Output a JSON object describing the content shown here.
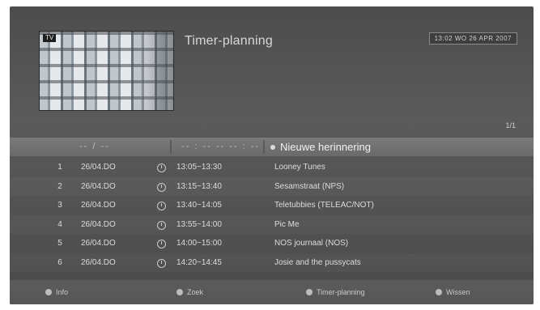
{
  "header": {
    "tv_tag": "TV",
    "title": "Timer-planning",
    "clock": "13:02 WO 26 APR 2007",
    "pager": "1/1"
  },
  "columns": {
    "date_placeholder": "-- / --",
    "time_placeholder": "-- : -- -- -- : --",
    "new_reminder": "Nieuwe herinnering"
  },
  "timers": [
    {
      "num": "1",
      "date": "26/04.DO",
      "time": "13:05~13:30",
      "program": "Looney Tunes"
    },
    {
      "num": "2",
      "date": "26/04.DO",
      "time": "13:15~13:40",
      "program": "Sesamstraat (NPS)"
    },
    {
      "num": "3",
      "date": "26/04.DO",
      "time": "13:40~14:05",
      "program": "Teletubbies (TELEAC/NOT)"
    },
    {
      "num": "4",
      "date": "26/04.DO",
      "time": "13:55~14:00",
      "program": "Pic Me"
    },
    {
      "num": "5",
      "date": "26/04.DO",
      "time": "14:00~15:00",
      "program": "NOS journaal (NOS)"
    },
    {
      "num": "6",
      "date": "26/04.DO",
      "time": "14:20~14:45",
      "program": "Josie and the pussycats"
    }
  ],
  "footer": {
    "info": "Info",
    "zoek": "Zoek",
    "timer_planning": "Timer-planning",
    "wissen": "Wissen"
  }
}
